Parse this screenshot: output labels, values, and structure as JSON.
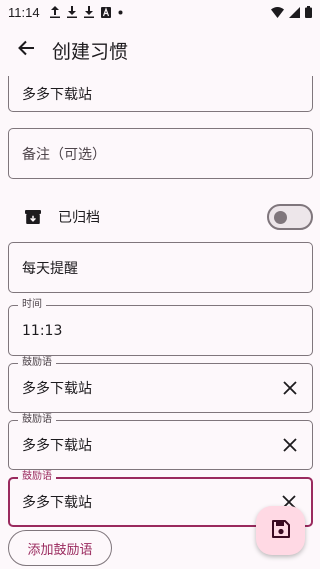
{
  "status_bar": {
    "time": "11:14",
    "left_icons": [
      "upload-icon",
      "download-icon",
      "download-icon",
      "a-icon",
      "dot-icon"
    ],
    "right_icons": [
      "wifi-icon",
      "signal-icon",
      "battery-icon"
    ]
  },
  "app_bar": {
    "back_icon": "arrow-back-icon",
    "title": "创建习惯"
  },
  "form": {
    "name_value": "多多下载站",
    "note_placeholder": "备注（可选）",
    "archive": {
      "icon": "archive-icon",
      "label": "已归档",
      "enabled": false
    },
    "frequency_value": "每天提醒",
    "time_field": {
      "label": "时间",
      "value": "11:13"
    },
    "encouragements": [
      {
        "label": "鼓励语",
        "value": "多多下载站",
        "focused": false
      },
      {
        "label": "鼓励语",
        "value": "多多下载站",
        "focused": false
      },
      {
        "label": "鼓励语",
        "value": "多多下载站",
        "focused": true
      }
    ],
    "add_button_label": "添加鼓励语"
  },
  "fab": {
    "icon": "save-icon"
  },
  "colors": {
    "background": "#fdf8fb",
    "primary": "#9a2a5e",
    "outline": "#7f767c",
    "fab_container": "#ffd9e4"
  }
}
